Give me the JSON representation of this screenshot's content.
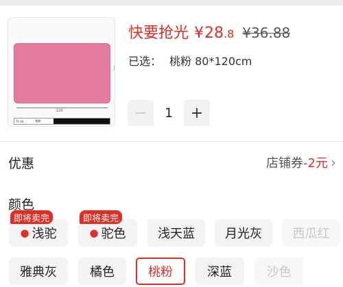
{
  "product": {
    "image_dim_right": "80",
    "image_dim_bottom": "120",
    "image_label": "桃粉",
    "image_code": "TF-04"
  },
  "price": {
    "tag": "快要抢光",
    "currency": "¥",
    "integer": "28",
    "decimal": ".8",
    "original": "¥36.88"
  },
  "selection": {
    "prefix": "已选：",
    "value": "桃粉 80*120cm"
  },
  "quantity": {
    "minus": "−",
    "value": "1",
    "plus": "+"
  },
  "discount": {
    "title": "优惠",
    "coupon_label": "店铺券",
    "coupon_amount": "-2元",
    "chevron": "›"
  },
  "colors": {
    "title": "颜色",
    "selling_out_badge": "即将卖完",
    "options": [
      {
        "label": "浅驼",
        "state": "selling-out"
      },
      {
        "label": "驼色",
        "state": "selling-out"
      },
      {
        "label": "浅天蓝",
        "state": "normal"
      },
      {
        "label": "月光灰",
        "state": "normal"
      },
      {
        "label": "西瓜红",
        "state": "disabled"
      },
      {
        "label": "雅典灰",
        "state": "normal"
      },
      {
        "label": "橘色",
        "state": "normal"
      },
      {
        "label": "桃粉",
        "state": "selected"
      },
      {
        "label": "深蓝",
        "state": "normal"
      },
      {
        "label": "沙色",
        "state": "disabled"
      }
    ]
  },
  "theme": {
    "accent": "#e02e24",
    "chip_bg": "#f3f3f3",
    "mat_color": "#e77aa1"
  }
}
